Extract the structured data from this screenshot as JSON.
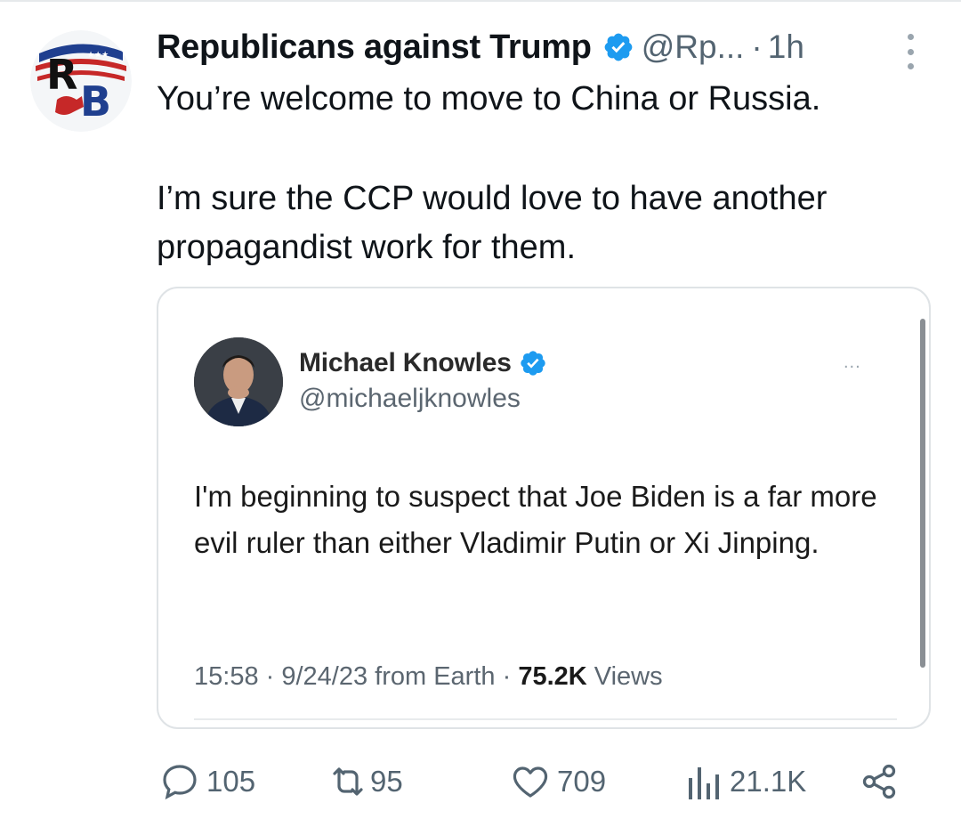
{
  "tweet": {
    "author_name": "Republicans against Trump",
    "handle": "@Rp...",
    "separator": "·",
    "time": "1h",
    "avatar_text": "RB",
    "text_paragraphs": [
      "You’re welcome to move to China or Russia.",
      "I’m sure the CCP would love to have another propagandist work for them."
    ]
  },
  "quote": {
    "author_name": "Michael Knowles",
    "handle": "@michaeljknowles",
    "more": "...",
    "text": "I'm beginning to suspect that Joe Biden is a far more evil ruler than either Vladimir Putin or Xi Jinping.",
    "meta_time": "15:58 · 9/24/23 from Earth · ",
    "meta_views_count": "75.2K",
    "meta_views_label": " Views"
  },
  "actions": {
    "replies": "105",
    "reposts": "95",
    "likes": "709",
    "views": "21.1K"
  },
  "colors": {
    "verified": "#1d9bf0",
    "secondary_text": "#536471",
    "border": "#dfe3e6"
  }
}
